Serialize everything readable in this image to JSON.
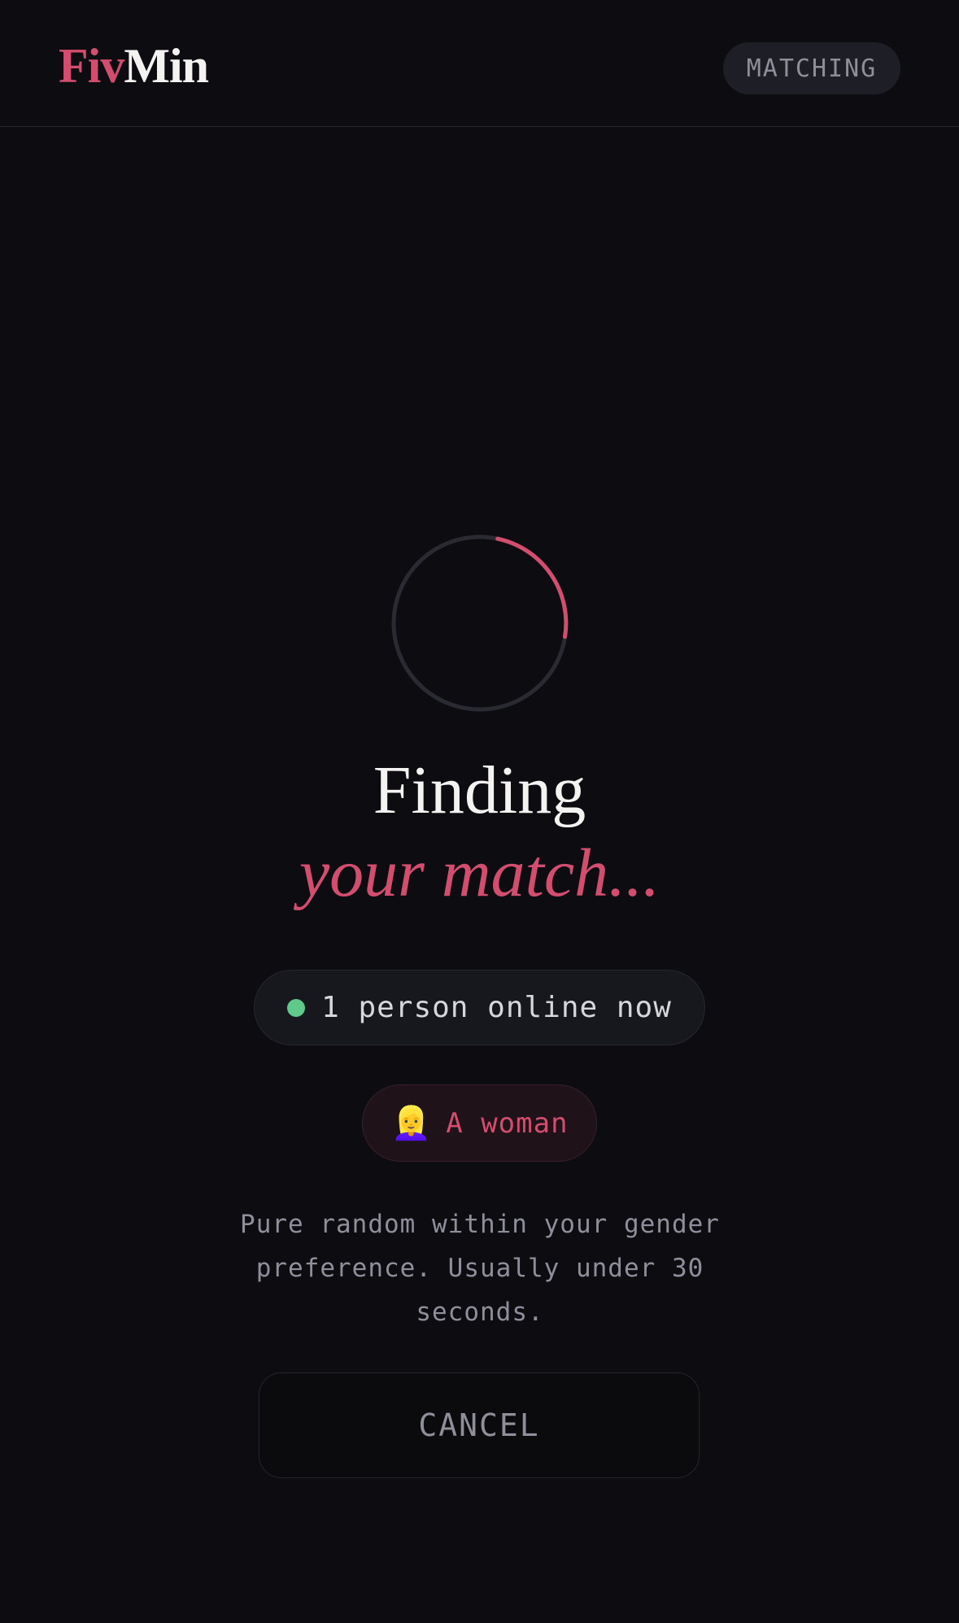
{
  "header": {
    "logo_part_1": "Fiv",
    "logo_part_2": "Min",
    "status_label": "MATCHING"
  },
  "main": {
    "spinner_icon": "loading-spinner",
    "title_line_1": "Finding",
    "title_line_2": "your match...",
    "online_status": {
      "indicator_color": "#5ec98a",
      "text": "1 person online now"
    },
    "preference": {
      "emoji": "👱‍♀️",
      "label": "A woman"
    },
    "description": "Pure random within your gender preference. Usually under 30 seconds.",
    "cancel_label": "CANCEL"
  },
  "colors": {
    "background": "#0d0d11",
    "accent": "#d24d6e",
    "online": "#5ec98a",
    "muted_text": "#8f8f9c"
  }
}
